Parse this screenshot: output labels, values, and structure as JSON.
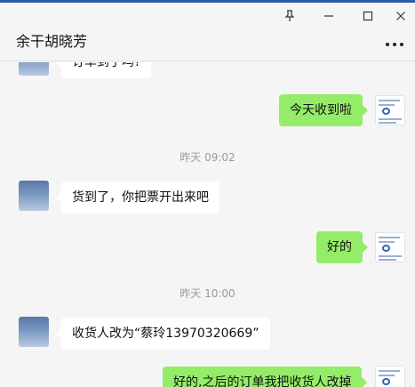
{
  "window": {
    "title": "余干胡晓芳",
    "pin_icon": "pin-icon",
    "minimize_icon": "minimize-icon",
    "maximize_icon": "maximize-icon",
    "close_icon": "close-icon",
    "more_icon": "more-icon"
  },
  "messages": [
    {
      "side": "left",
      "text": "订单到了吗?"
    },
    {
      "side": "right",
      "text": "今天收到啦"
    },
    {
      "type": "timestamp",
      "text": "昨天 09:02"
    },
    {
      "side": "left",
      "text": "货到了，你把票开出来吧"
    },
    {
      "side": "right",
      "text": "好的"
    },
    {
      "type": "timestamp",
      "text": "昨天 10:00"
    },
    {
      "side": "left",
      "text": "收货人改为“蔡玲13970320669”"
    },
    {
      "side": "right",
      "text": "好的,之后的订单我把收货人改掉"
    }
  ],
  "colors": {
    "accent_top": "#2a5aa8",
    "bubble_self": "#95ec69",
    "bubble_other": "#ffffff",
    "chat_bg": "#f5f5f5",
    "timestamp": "#9a9a9a"
  }
}
